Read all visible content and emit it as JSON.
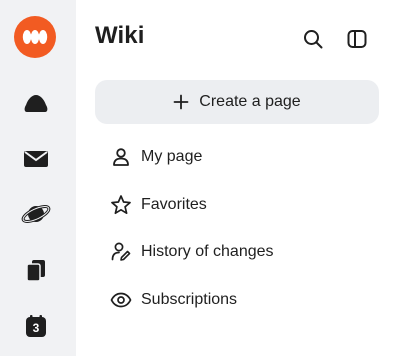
{
  "rail": {
    "items": [
      {
        "icon": "logo-icon"
      },
      {
        "icon": "cloud-icon"
      },
      {
        "icon": "mail-icon"
      },
      {
        "icon": "planet-icon"
      },
      {
        "icon": "cards-icon"
      },
      {
        "icon": "calendar-icon",
        "badge": "3"
      }
    ]
  },
  "panel": {
    "title": "Wiki",
    "create_label": "Create a page",
    "nav": [
      {
        "label": "My page",
        "icon": "user-icon"
      },
      {
        "label": "Favorites",
        "icon": "star-icon"
      },
      {
        "label": "History of changes",
        "icon": "user-edit-icon"
      },
      {
        "label": "Subscriptions",
        "icon": "eye-icon"
      }
    ]
  },
  "colors": {
    "brand": "#f25b22",
    "rail_bg": "#f1f2f4",
    "button_bg": "#eceef1",
    "text": "#1f1f1f"
  }
}
